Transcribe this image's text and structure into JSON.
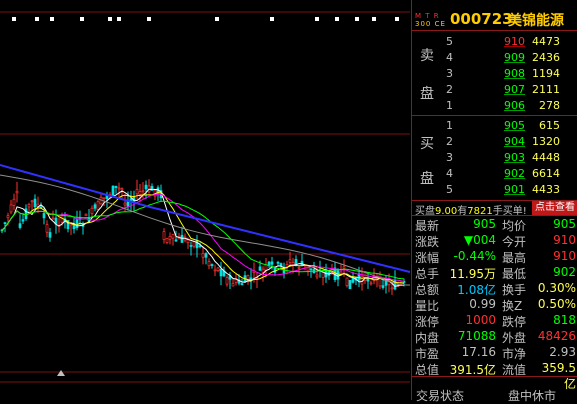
{
  "stock": {
    "mtr_top": "M T R",
    "mtr_bottom": "300 CE",
    "code": "000723",
    "name": "美锦能源"
  },
  "order_book": {
    "sell_label_top": "卖",
    "sell_label_bottom": "盘",
    "buy_label_top": "买",
    "buy_label_bottom": "盘",
    "asks": [
      {
        "level": "5",
        "price": "910",
        "volume": "4473",
        "color": "red"
      },
      {
        "level": "4",
        "price": "909",
        "volume": "2436",
        "color": "green"
      },
      {
        "level": "3",
        "price": "908",
        "volume": "1194",
        "color": "green"
      },
      {
        "level": "2",
        "price": "907",
        "volume": "2111",
        "color": "green"
      },
      {
        "level": "1",
        "price": "906",
        "volume": "278",
        "color": "green"
      }
    ],
    "bids": [
      {
        "level": "1",
        "price": "905",
        "volume": "615",
        "color": "green"
      },
      {
        "level": "2",
        "price": "904",
        "volume": "1320",
        "color": "green"
      },
      {
        "level": "3",
        "price": "903",
        "volume": "4448",
        "color": "green"
      },
      {
        "level": "4",
        "price": "902",
        "volume": "6614",
        "color": "green"
      },
      {
        "level": "5",
        "price": "901",
        "volume": "4433",
        "color": "green"
      }
    ]
  },
  "message": {
    "prefix": "买盘",
    "price": "9.00",
    "middle": "有",
    "qty": "7821",
    "suffix": "手买单!",
    "button": "点击查看"
  },
  "quotes": [
    {
      "l1": "最新",
      "v1": "905",
      "c1": "#00ff00",
      "l2": "均价",
      "v2": "905",
      "c2": "#00ff00"
    },
    {
      "l1": "涨跌",
      "v1": "▼004",
      "c1": "#00ff00",
      "l2": "今开",
      "v2": "910",
      "c2": "#ff3030"
    },
    {
      "l1": "涨幅",
      "v1": "-0.44%",
      "c1": "#00ff00",
      "l2": "最高",
      "v2": "910",
      "c2": "#ff3030"
    },
    {
      "l1": "总手",
      "v1": "11.95万",
      "c1": "#ffff55",
      "l2": "最低",
      "v2": "902",
      "c2": "#00ff00"
    },
    {
      "l1": "总额",
      "v1": "1.08亿",
      "c1": "#00c8ff",
      "l2": "换手",
      "v2": "0.30%",
      "c2": "#ffff55"
    },
    {
      "l1": "量比",
      "v1": "0.99",
      "c1": "#c0c0c0",
      "l2": "换Z",
      "v2": "0.50%",
      "c2": "#ffff55"
    },
    {
      "l1": "涨停",
      "v1": "1000",
      "c1": "#ff3030",
      "l2": "跌停",
      "v2": "818",
      "c2": "#00ff00"
    },
    {
      "l1": "内盘",
      "v1": "71088",
      "c1": "#00ff00",
      "l2": "外盘",
      "v2": "48426",
      "c2": "#ff3030"
    },
    {
      "l1": "市盈",
      "v1": "17.16",
      "c1": "#c0c0c0",
      "l2": "市净",
      "v2": "2.93",
      "c2": "#c0c0c0"
    },
    {
      "l1": "总值",
      "v1": "391.5亿",
      "c1": "#ffff55",
      "l2": "流值",
      "v2": "359.5亿",
      "c2": "#ffff55"
    }
  ],
  "footer": {
    "left": "交易状态",
    "right": "盘中休市"
  },
  "colors": {
    "up": "#ff3030",
    "down": "#00ff00",
    "accent": "#ffcc00",
    "grid": "#8a1a1a",
    "ma_long": "#3030ff"
  }
}
